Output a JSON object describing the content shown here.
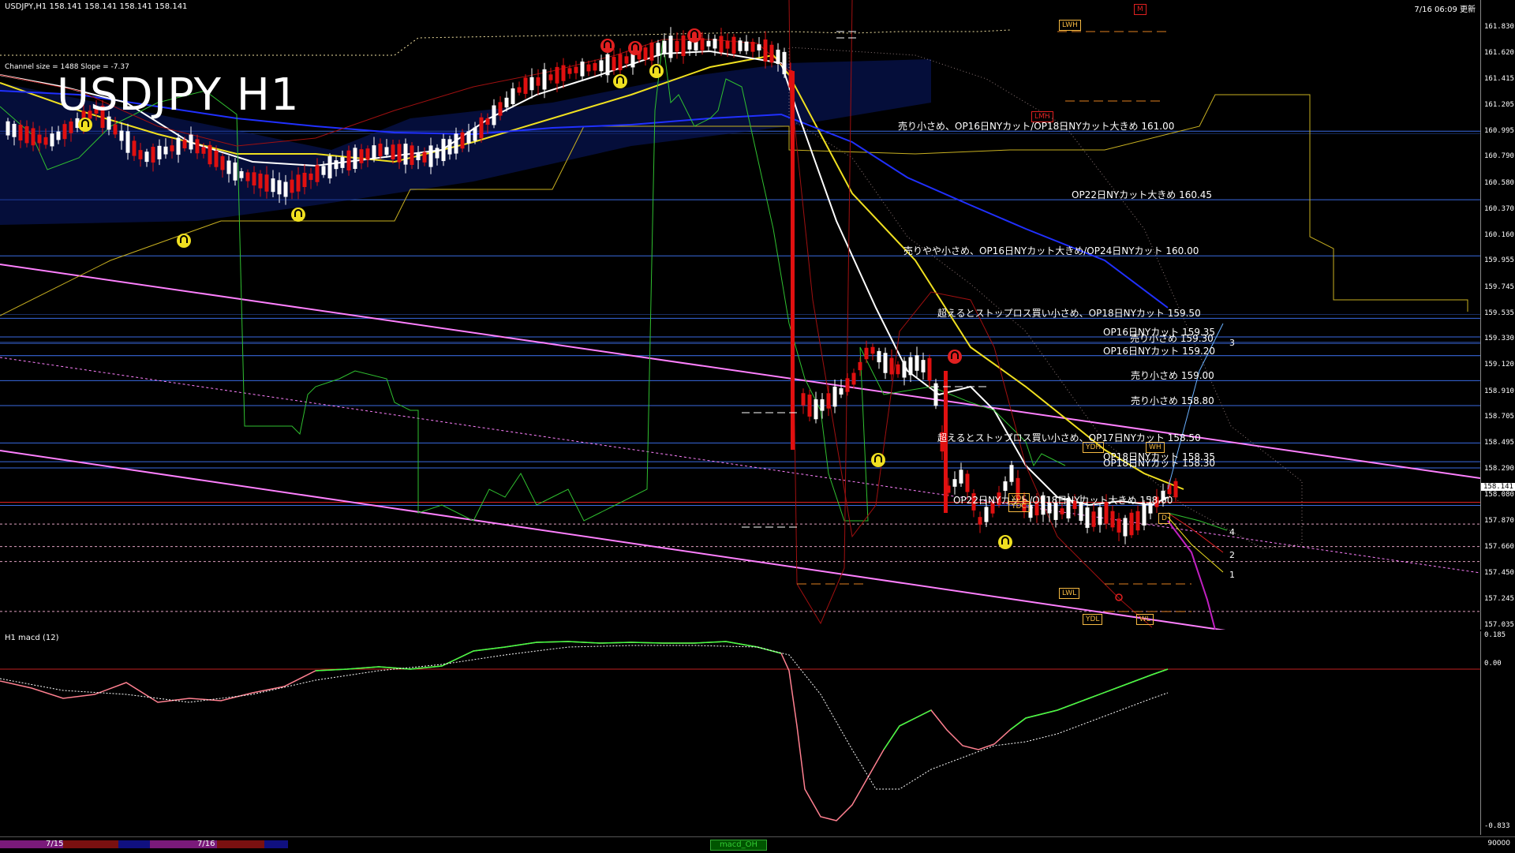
{
  "header": {
    "info": "USDJPY,H1  158.141 158.141 158.141 158.141",
    "clock": "7/16 06:09 更新"
  },
  "chart": {
    "title": "USDJPY H1",
    "channel_info": "Channel size = 1488 Slope = -7.37",
    "current_price": "158.141"
  },
  "price_axis": [
    "161.830",
    "161.620",
    "161.415",
    "161.205",
    "160.995",
    "160.790",
    "160.580",
    "160.370",
    "160.160",
    "159.955",
    "159.745",
    "159.535",
    "159.330",
    "159.120",
    "158.910",
    "158.705",
    "158.495",
    "158.290",
    "158.080",
    "157.870",
    "157.660",
    "157.450",
    "157.245",
    "157.035"
  ],
  "levels": [
    {
      "text": "売り小さめ、OP16日NYカット/OP18日NYカット大きめ 161.00",
      "price": 161.0
    },
    {
      "text": "OP22日NYカット大きめ 160.45",
      "price": 160.45
    },
    {
      "text": "売りやや小さめ、OP16日NYカット大きめ/OP24日NYカット 160.00",
      "price": 160.0
    },
    {
      "text": "超えるとストップロス買い小さめ、OP18日NYカット 159.50",
      "price": 159.5
    },
    {
      "text": "OP16日NYカット 159.35",
      "price": 159.35
    },
    {
      "text": "売り小さめ 159.30",
      "price": 159.3
    },
    {
      "text": "OP16日NYカット 159.20",
      "price": 159.2
    },
    {
      "text": "売り小さめ 159.00",
      "price": 159.0
    },
    {
      "text": "売り小さめ 158.80",
      "price": 158.8
    },
    {
      "text": "超えるとストップロス買い小さめ、OP17日NYカット 158.50",
      "price": 158.5
    },
    {
      "text": "OP18日NYカット 158.35",
      "price": 158.35
    },
    {
      "text": "OP18日NYカット 158.30",
      "price": 158.3
    },
    {
      "text": "OP22日NYカット/OP18日NYカット大きめ 158.00",
      "price": 158.0
    }
  ],
  "markers": {
    "lwh": "LWH",
    "lmh": "LMH",
    "m": "M",
    "ydh": "YDH",
    "wh": "WH",
    "ydc1": "YDC",
    "ydc2": "YDC",
    "lwl": "LWL",
    "ydl": "YDL",
    "wl": "WL",
    "d": "D"
  },
  "projection_numbers": [
    "3",
    "4",
    "2",
    "1"
  ],
  "macd": {
    "label": "H1  macd (12)",
    "axis": [
      "0.185",
      "0.00",
      "-0.833"
    ]
  },
  "bottom": {
    "date1": "7/15",
    "date2": "7/16",
    "tab": "macd_OH",
    "right": "90000"
  },
  "colors": {
    "bull": "#ffffff",
    "bear": "#e01010",
    "ma_white": "#ffffff",
    "ma_yellow": "#f0e020",
    "ma_blue": "#2030ff",
    "channel": "#ff80ff",
    "level_line": "#3a6ae0",
    "cloud": "#c8a8a8",
    "green": "#30c030",
    "macd_pos": "#40ff40",
    "macd_neg": "#ff8090"
  }
}
